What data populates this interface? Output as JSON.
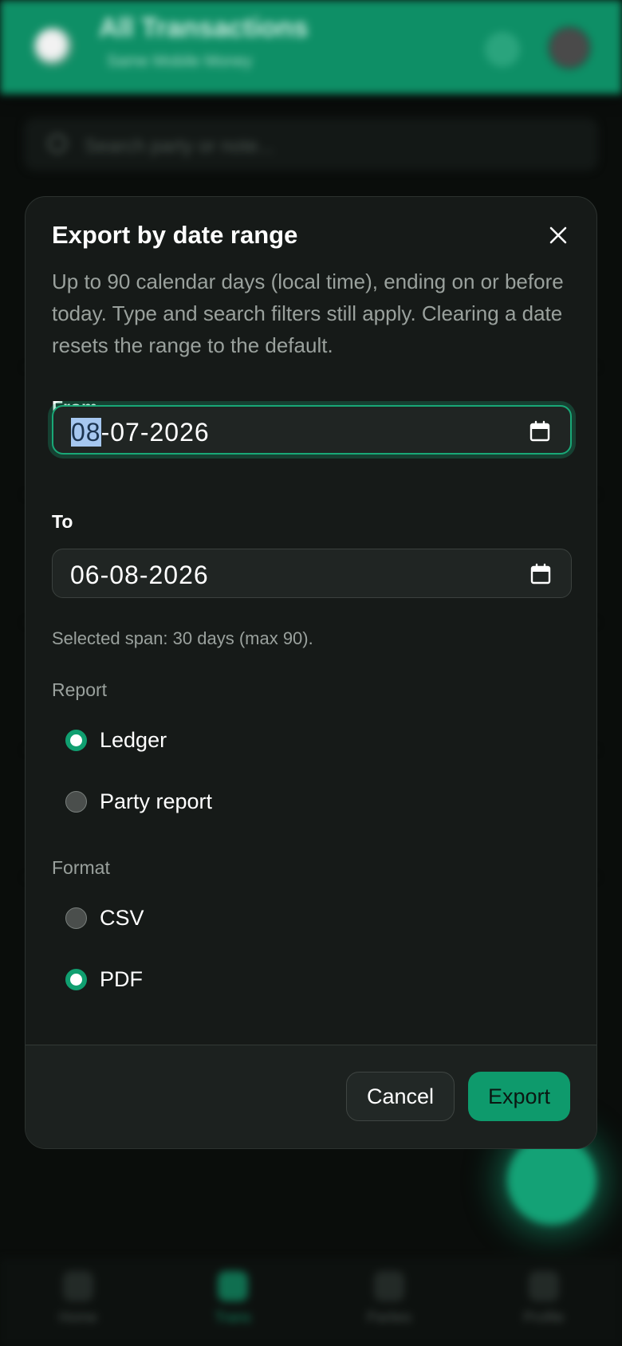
{
  "background": {
    "app_title": "All Transactions",
    "app_subtitle": "Same Mobile Money",
    "search_placeholder": "Search party or note...",
    "nav": [
      {
        "label": "Home",
        "icon": "home-icon"
      },
      {
        "label": "Trans",
        "icon": "phone-icon"
      },
      {
        "label": "Parties",
        "icon": "people-icon"
      },
      {
        "label": "Profile",
        "icon": "profile-icon"
      }
    ]
  },
  "modal": {
    "title": "Export by date range",
    "description": "Up to 90 calendar days (local time), ending on or before today. Type and search filters still apply. Clearing a date resets the range to the default.",
    "from": {
      "label": "From",
      "day": "08",
      "rest": "-07-2026"
    },
    "to": {
      "label": "To",
      "value": "06-08-2026"
    },
    "span_hint": "Selected span: 30 days (max 90).",
    "report": {
      "label": "Report",
      "options": [
        "Ledger",
        "Party report"
      ],
      "selected": "Ledger"
    },
    "format": {
      "label": "Format",
      "options": [
        "CSV",
        "PDF"
      ],
      "selected": "PDF"
    },
    "cancel_label": "Cancel",
    "export_label": "Export"
  },
  "colors": {
    "accent": "#0e9a6c",
    "appbar": "#0e8f66",
    "modal_bg": "#161a18",
    "footer_bg": "#1c211f"
  }
}
